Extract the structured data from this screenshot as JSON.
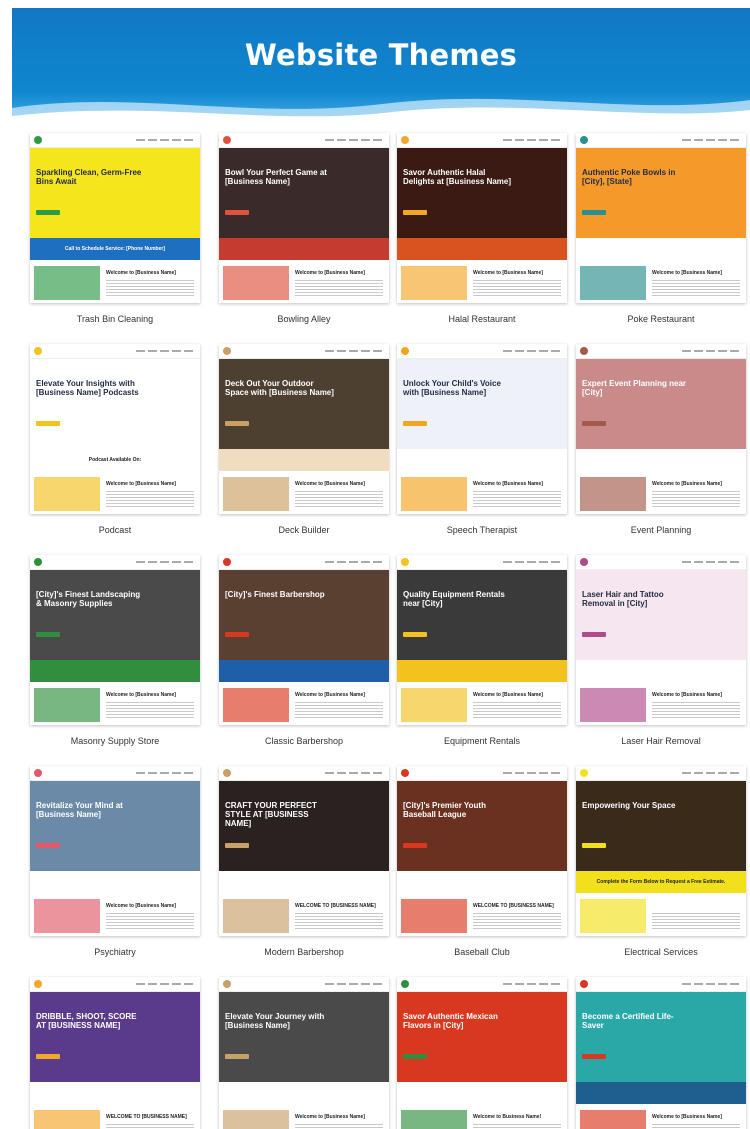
{
  "header": {
    "title": "Website Themes"
  },
  "themes": [
    {
      "label": "Trash Bin Cleaning",
      "hero_text": "Sparkling Clean, Germ-Free Bins Await",
      "band_text": "Call to Schedule Service: [Phone Number]",
      "lower_title": "Welcome to [Business Name]",
      "hero_color": "#f5e51c",
      "band_color": "#1f6fc0",
      "accent": "#2e9a46"
    },
    {
      "label": "Bowling Alley",
      "hero_text": "Bowl Your Perfect Game at [Business Name]",
      "band_text": "",
      "lower_title": "Welcome to [Business Name]",
      "hero_color": "#3b2a2a",
      "band_color": "#c63b2f",
      "accent": "#e0523f"
    },
    {
      "label": "Halal Restaurant",
      "hero_text": "Savor Authentic Halal Delights at [Business Name]",
      "band_text": "",
      "lower_title": "Welcome to [Business Name]",
      "hero_color": "#3a1a12",
      "band_color": "#d8531f",
      "accent": "#f2a62a"
    },
    {
      "label": "Poke Restaurant",
      "hero_text": "Authentic Poke Bowls in [City], [State]",
      "band_text": "",
      "lower_title": "Welcome to [Business Name]",
      "hero_color": "#f59a2a",
      "band_color": "#ffffff",
      "accent": "#2a8f8f"
    },
    {
      "label": "Podcast",
      "hero_text": "Elevate Your Insights with [Business Name] Podcasts",
      "band_text": "Podcast Available On:",
      "lower_title": "Welcome to [Business Name]",
      "hero_color": "#ffffff",
      "band_color": "#ffffff",
      "accent": "#f2c21d"
    },
    {
      "label": "Deck Builder",
      "hero_text": "Deck Out Your Outdoor Space with [Business Name]",
      "band_text": "",
      "lower_title": "Welcome to [Business Name]",
      "hero_color": "#4d4030",
      "band_color": "#f0ddc0",
      "accent": "#c9a066"
    },
    {
      "label": "Speech Therapist",
      "hero_text": "Unlock Your Child's Voice with [Business Name]",
      "band_text": "",
      "lower_title": "Welcome to [Business Name]",
      "hero_color": "#eef2f8",
      "band_color": "#ffffff",
      "accent": "#f3a51f"
    },
    {
      "label": "Event Planning",
      "hero_text": "Expert Event Planning near [City]",
      "band_text": "",
      "lower_title": "Welcome to [Business Name]",
      "hero_color": "#c98a8a",
      "band_color": "#ffffff",
      "accent": "#a35a4a"
    },
    {
      "label": "Masonry Supply Store",
      "hero_text": "[City]'s Finest Landscaping & Masonry Supplies",
      "band_text": "",
      "lower_title": "Welcome to [Business Name]",
      "hero_color": "#4a4a4a",
      "band_color": "#2f8f3f",
      "accent": "#2f8f3f"
    },
    {
      "label": "Classic Barbershop",
      "hero_text": "[City]'s Finest Barbershop",
      "band_text": "",
      "lower_title": "Welcome to [Business Name]",
      "hero_color": "#5a4030",
      "band_color": "#1f5fa8",
      "accent": "#d8381f"
    },
    {
      "label": "Equipment Rentals",
      "hero_text": "Quality Equipment Rentals near [City]",
      "band_text": "",
      "lower_title": "Welcome to [Business Name]",
      "hero_color": "#3a3a3a",
      "band_color": "#f2c21d",
      "accent": "#f2c21d"
    },
    {
      "label": "Laser Hair Removal",
      "hero_text": "Laser Hair and Tattoo Removal in [City]",
      "band_text": "",
      "lower_title": "Welcome to [Business Name]",
      "hero_color": "#f5e6ef",
      "band_color": "#ffffff",
      "accent": "#b04a8a"
    },
    {
      "label": "Psychiatry",
      "hero_text": "Revitalize Your Mind at [Business Name]",
      "band_text": "",
      "lower_title": "Welcome to [Business Name]",
      "hero_color": "#6a8aa8",
      "band_color": "#ffffff",
      "accent": "#e05a6a"
    },
    {
      "label": "Modern Barbershop",
      "hero_text": "CRAFT YOUR PERFECT STYLE AT [BUSINESS NAME]",
      "band_text": "",
      "lower_title": "WELCOME TO [BUSINESS NAME]",
      "hero_color": "#2a2220",
      "band_color": "#ffffff",
      "accent": "#c9a06a"
    },
    {
      "label": "Baseball Club",
      "hero_text": "[City]'s Premier Youth Baseball League",
      "band_text": "",
      "lower_title": "WELCOME TO [BUSINESS NAME]",
      "hero_color": "#6a3020",
      "band_color": "#ffffff",
      "accent": "#d8381f"
    },
    {
      "label": "Electrical Services",
      "hero_text": "Empowering Your Space",
      "band_text": "Complete the Form Below to Request a Free Estimate.",
      "lower_title": "",
      "hero_color": "#3a2a1a",
      "band_color": "#f2e01d",
      "accent": "#f2e01d"
    },
    {
      "label": "",
      "hero_text": "DRIBBLE, SHOOT, SCORE AT [BUSINESS NAME]",
      "band_text": "",
      "lower_title": "WELCOME TO [BUSINESS NAME]",
      "hero_color": "#5a3a8a",
      "band_color": "#ffffff",
      "accent": "#f2a62a"
    },
    {
      "label": "",
      "hero_text": "Elevate Your Journey with [Business Name]",
      "band_text": "",
      "lower_title": "Welcome to [Business Name]",
      "hero_color": "#4a4a4a",
      "band_color": "#ffffff",
      "accent": "#c9a06a"
    },
    {
      "label": "",
      "hero_text": "Savor Authentic Mexican Flavors in [City]",
      "band_text": "",
      "lower_title": "Welcome to Business Name!",
      "hero_color": "#d8381f",
      "band_color": "#ffffff",
      "accent": "#2f8f3f"
    },
    {
      "label": "",
      "hero_text": "Become a Certified Life-Saver",
      "band_text": "",
      "lower_title": "Welcome to [Business Name]",
      "hero_color": "#2aa8a8",
      "band_color": "#1f5f8f",
      "accent": "#d8381f"
    }
  ]
}
